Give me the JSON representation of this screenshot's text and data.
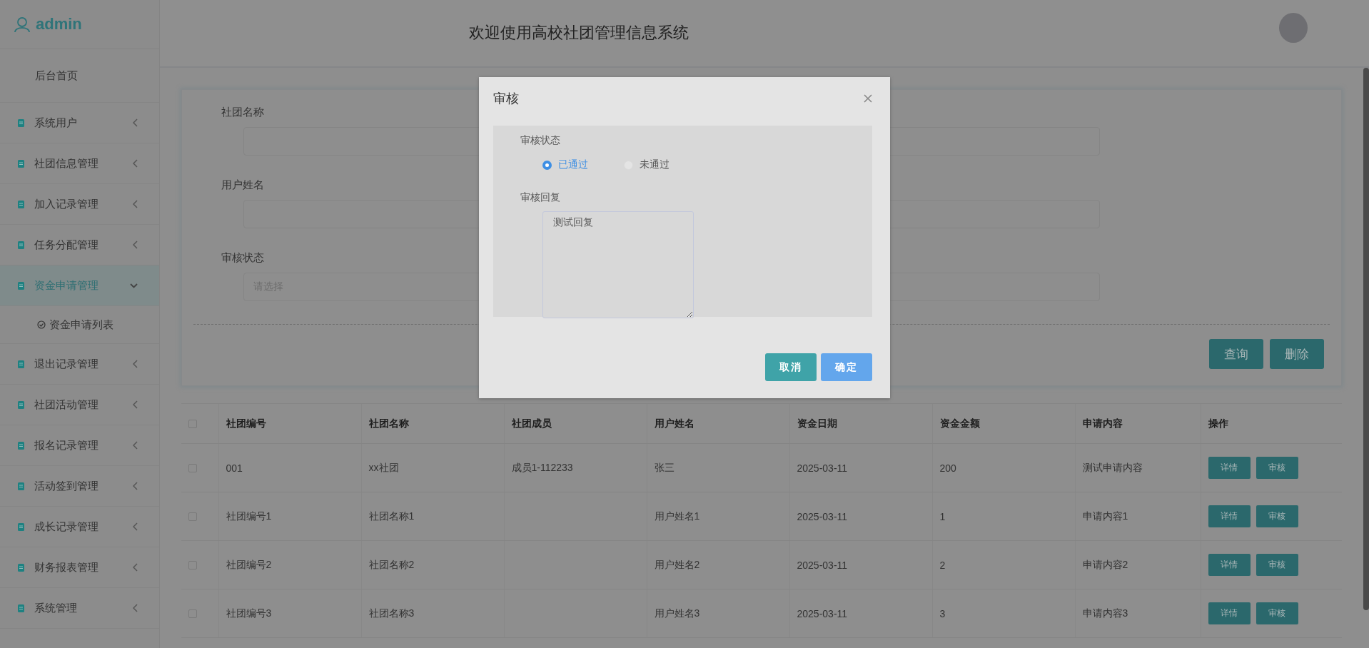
{
  "sidebar": {
    "user": "admin",
    "items": [
      {
        "kind": "link",
        "label": "后台首页"
      },
      {
        "kind": "group",
        "label": "系统用户",
        "expanded": false
      },
      {
        "kind": "group",
        "label": "社团信息管理",
        "expanded": false
      },
      {
        "kind": "group",
        "label": "加入记录管理",
        "expanded": false
      },
      {
        "kind": "group",
        "label": "任务分配管理",
        "expanded": false
      },
      {
        "kind": "group",
        "label": "资金申请管理",
        "expanded": true,
        "children": [
          {
            "label": "资金申请列表"
          }
        ]
      },
      {
        "kind": "group",
        "label": "退出记录管理",
        "expanded": false
      },
      {
        "kind": "group",
        "label": "社团活动管理",
        "expanded": false
      },
      {
        "kind": "group",
        "label": "报名记录管理",
        "expanded": false
      },
      {
        "kind": "group",
        "label": "活动签到管理",
        "expanded": false
      },
      {
        "kind": "group",
        "label": "成长记录管理",
        "expanded": false
      },
      {
        "kind": "group",
        "label": "财务报表管理",
        "expanded": false
      },
      {
        "kind": "group",
        "label": "系统管理",
        "expanded": false
      }
    ]
  },
  "header": {
    "title": "欢迎使用高校社团管理信息系统"
  },
  "search": {
    "fields": [
      {
        "label": "社团名称",
        "kind": "text"
      },
      {
        "label": "用户姓名",
        "kind": "text"
      },
      {
        "label": "审核状态",
        "kind": "select",
        "placeholder": "请选择"
      }
    ],
    "buttons": [
      "查询",
      "删除"
    ]
  },
  "table": {
    "select_all_checked": false,
    "columns": [
      "社团编号",
      "社团名称",
      "社团成员",
      "用户姓名",
      "资金日期",
      "资金金额",
      "申请内容",
      "操作"
    ],
    "rows": [
      {
        "checked": false,
        "club_no": "001",
        "club_name": "xx社团",
        "member": "成员1-112233",
        "user_name": "张三",
        "date": "2025-03-11",
        "amount": "200",
        "content": "测试申请内容",
        "actions": [
          "详情",
          "审核"
        ]
      },
      {
        "checked": false,
        "club_no": "社团编号1",
        "club_name": "社团名称1",
        "user_name": "用户姓名1",
        "date": "2025-03-11",
        "amount": "1",
        "content": "申请内容1",
        "actions": [
          "详情",
          "审核"
        ]
      },
      {
        "checked": false,
        "club_no": "社团编号2",
        "club_name": "社团名称2",
        "user_name": "用户姓名2",
        "date": "2025-03-11",
        "amount": "2",
        "content": "申请内容2",
        "actions": [
          "详情",
          "审核"
        ]
      },
      {
        "checked": false,
        "club_no": "社团编号3",
        "club_name": "社团名称3",
        "user_name": "用户姓名3",
        "date": "2025-03-11",
        "amount": "3",
        "content": "申请内容3",
        "actions": [
          "详情",
          "审核"
        ]
      }
    ]
  },
  "dialog": {
    "title": "审核",
    "status_label": "审核状态",
    "status_options": [
      {
        "label": "已通过",
        "selected": true
      },
      {
        "label": "未通过",
        "selected": false
      }
    ],
    "reply_label": "审核回复",
    "reply_value": "测试回复",
    "buttons": [
      {
        "kind": "cancel",
        "label": "取消"
      },
      {
        "kind": "confirm",
        "label": "确定"
      }
    ]
  }
}
